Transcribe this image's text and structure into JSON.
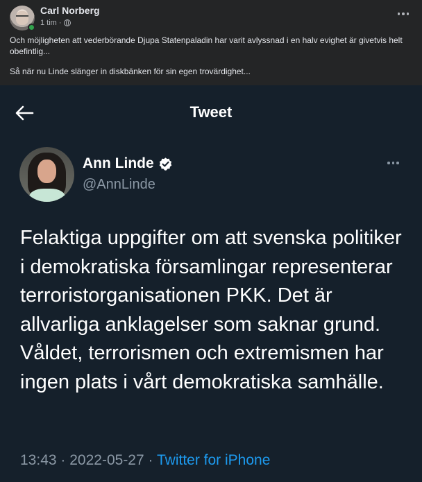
{
  "post": {
    "author": "Carl Norberg",
    "time": "1 tim",
    "separator": "·",
    "paragraphs": [
      "Och möjligheten att vederbörande Djupa Statenpaladin har varit avlyssnad i en halv evighet är givetvis helt obefintlig...",
      "Så när nu Linde slänger in diskbänken för sin egen trovärdighet..."
    ]
  },
  "tweet": {
    "header_title": "Tweet",
    "author_name": "Ann Linde",
    "author_handle": "@AnnLinde",
    "body": "Felaktiga uppgifter om att svenska politiker i demokratiska församlingar representerar terroristorganisationen PKK. Det är allvarliga anklagelser som saknar grund. Våldet, terrorismen och extremismen har ingen plats i vårt demokratiska samhälle.",
    "time": "13:43",
    "date": "2022-05-27",
    "separator": "·",
    "source": "Twitter for iPhone"
  },
  "icons": {
    "post_avatar": "avatar-photo",
    "online": "online-status-dot",
    "audience": "globe-icon",
    "post_more": "more-options-icon",
    "back": "arrow-left-icon",
    "verified": "verified-badge-icon",
    "tweet_more": "more-options-icon"
  },
  "colors": {
    "facebook_bg": "#242526",
    "twitter_bg": "#15202b",
    "link_blue": "#1d9bf0",
    "online_green": "#31a24c"
  }
}
